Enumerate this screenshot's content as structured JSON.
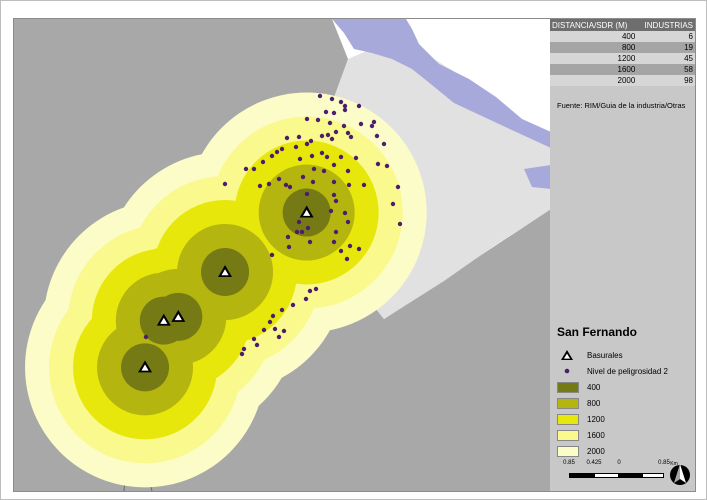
{
  "map_title": "San Fernando",
  "distance_table": {
    "headers": [
      "DISTANCIA/SDR (M)",
      "INDUSTRIAS"
    ],
    "rows": [
      {
        "distance": "400",
        "industries": "6"
      },
      {
        "distance": "800",
        "industries": "19"
      },
      {
        "distance": "1200",
        "industries": "45"
      },
      {
        "distance": "1600",
        "industries": "58"
      },
      {
        "distance": "2000",
        "industries": "98"
      }
    ]
  },
  "source": "Fuente: RIM/Guia de la industria/Otras",
  "legend": {
    "points": [
      {
        "label": "Basurales",
        "symbol": "triangle-icon"
      },
      {
        "label": "Nivel de peligrosidad 2",
        "symbol": "dot-icon",
        "color": "#4b1d6e"
      }
    ],
    "buffers": [
      {
        "label": "400",
        "color": "#767a14"
      },
      {
        "label": "800",
        "color": "#b4b50e"
      },
      {
        "label": "1200",
        "color": "#e7e70b"
      },
      {
        "label": "1600",
        "color": "#f9f98e"
      },
      {
        "label": "2000",
        "color": "#fcfcc9"
      }
    ]
  },
  "scale_labels": [
    "0.85",
    "0.425",
    "0",
    "0.85"
  ],
  "scale_units": "Km",
  "map": {
    "colors": {
      "land_gray": "#a8a8a8",
      "land_light": "#e1e1e1",
      "water": "#a6a9da",
      "road": "#6b6b6b"
    },
    "basurales": [
      {
        "lon_rel": 0.545,
        "lat_rel": 0.41
      },
      {
        "lon_rel": 0.393,
        "lat_rel": 0.536
      },
      {
        "lon_rel": 0.306,
        "lat_rel": 0.631
      },
      {
        "lon_rel": 0.279,
        "lat_rel": 0.639
      },
      {
        "lon_rel": 0.244,
        "lat_rel": 0.738
      }
    ]
  }
}
